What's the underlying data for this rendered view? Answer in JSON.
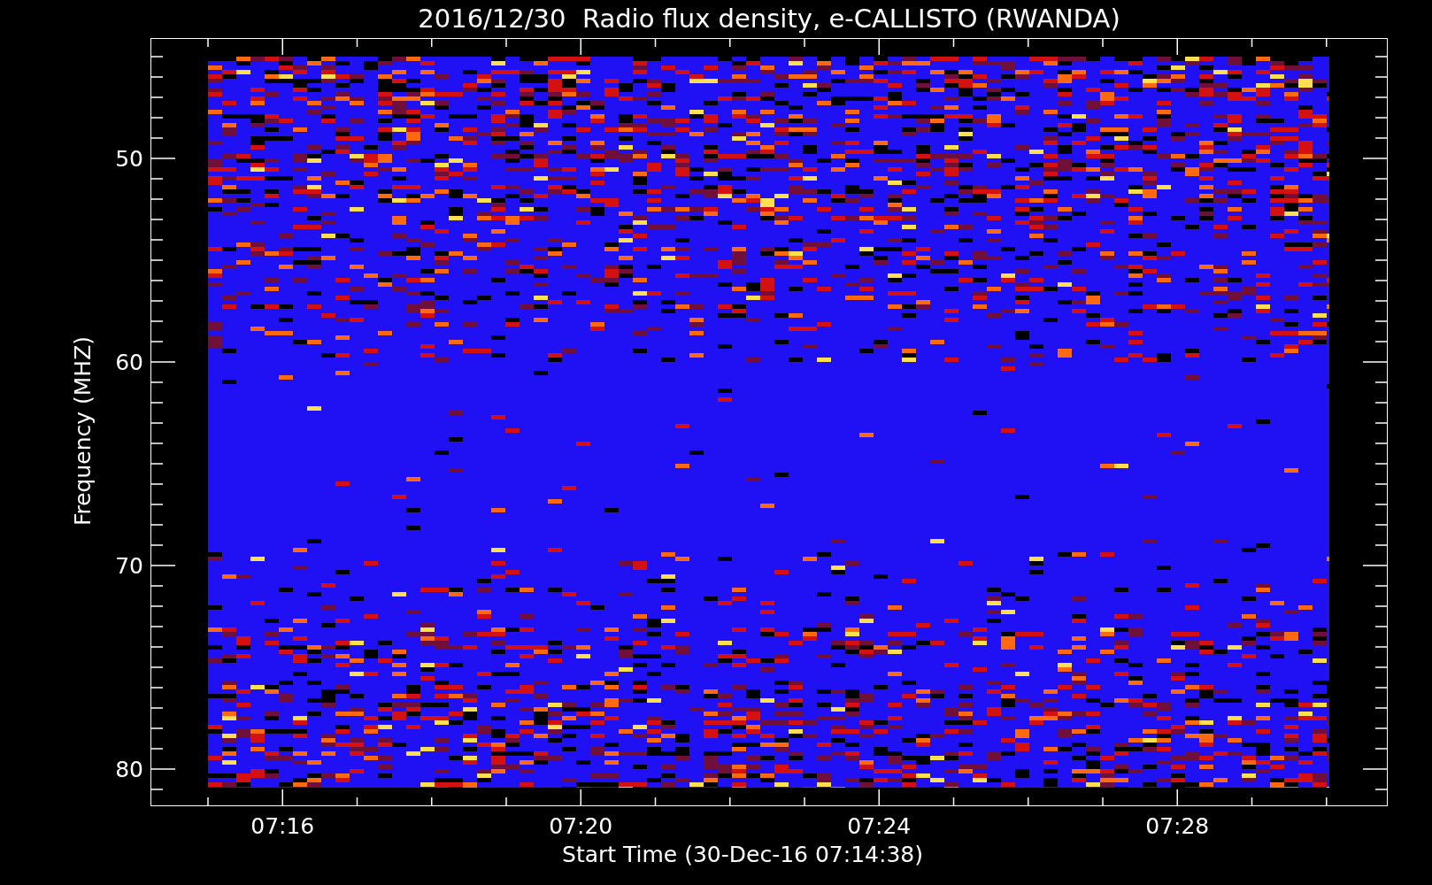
{
  "title": "2016/12/30  Radio flux density, e-CALLISTO (RWANDA)",
  "y_axis": {
    "label": "Frequency (MHZ)",
    "ticks": [
      "50",
      "60",
      "70",
      "80"
    ]
  },
  "x_axis": {
    "label": "Start Time (30-Dec-16 07:14:38)",
    "ticks": [
      "07:16",
      "07:20",
      "07:24",
      "07:28"
    ]
  }
}
